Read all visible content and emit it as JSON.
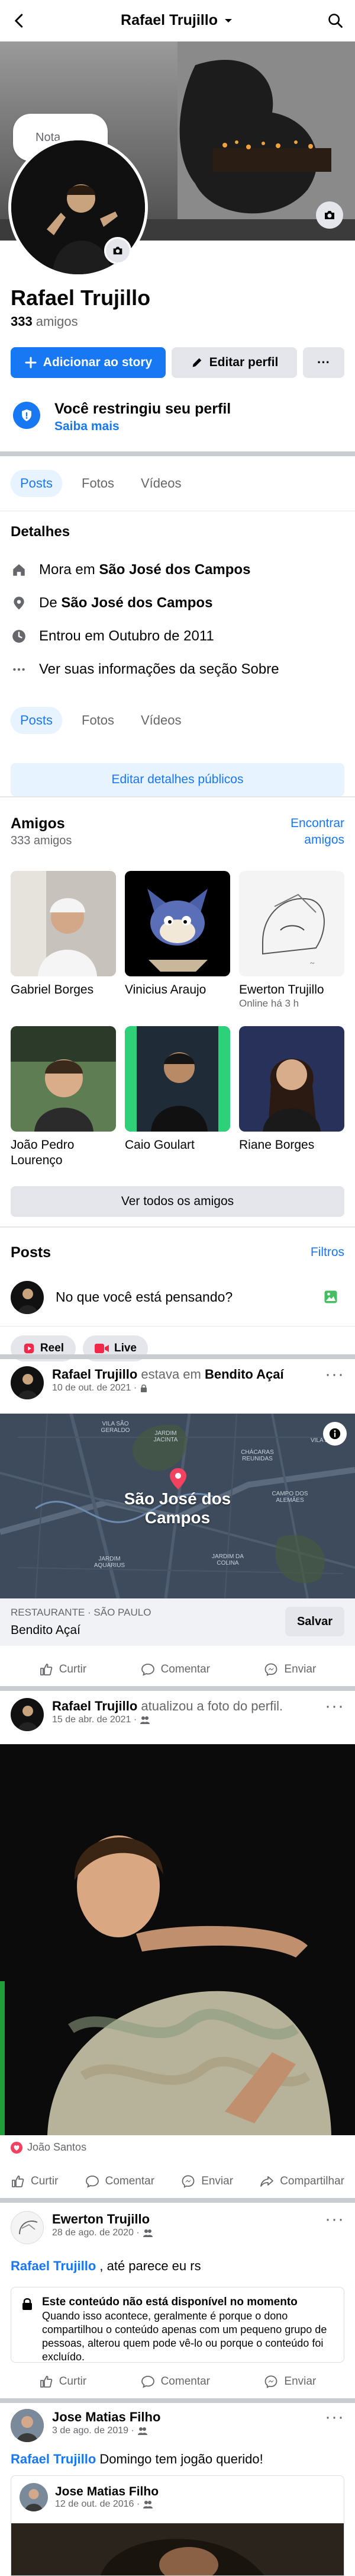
{
  "header": {
    "title": "Rafael Trujillo"
  },
  "profile": {
    "note_placeholder": "Nota...",
    "name": "Rafael Trujillo",
    "friends_count": "333",
    "friends_word": "amigos",
    "add_story": "Adicionar ao story",
    "edit_profile": "Editar perfil",
    "more": "···"
  },
  "restriction": {
    "title": "Você restringiu seu perfil",
    "link": "Saiba mais"
  },
  "tabs": [
    "Posts",
    "Fotos",
    "Vídeos"
  ],
  "details": {
    "heading": "Detalhes",
    "lives_prefix": "Mora em ",
    "lives_city": "São José dos Campos",
    "from_prefix": "De ",
    "from_city": "São José dos Campos",
    "joined": "Entrou em Outubro de 2011",
    "see_more": "Ver suas informações da seção Sobre",
    "edit_public": "Editar detalhes públicos"
  },
  "friends": {
    "heading": "Amigos",
    "count": "333 amigos",
    "find": "Encontrar amigos",
    "see_all": "Ver todos os amigos",
    "items": [
      {
        "name": "Gabriel Borges",
        "sub": ""
      },
      {
        "name": "Vinicius Araujo",
        "sub": ""
      },
      {
        "name": "Ewerton Trujillo",
        "sub": "Online há 3 h"
      },
      {
        "name": "João Pedro Lourenço",
        "sub": ""
      },
      {
        "name": "Caio Goulart",
        "sub": ""
      },
      {
        "name": "Riane Borges",
        "sub": ""
      }
    ]
  },
  "posts_section": {
    "heading": "Posts",
    "filters": "Filtros",
    "composer_placeholder": "No que você está pensando?",
    "reel": "Reel",
    "live": "Live"
  },
  "post1": {
    "author": "Rafael Trujillo",
    "action": " estava em ",
    "place": "Bendito Açaí",
    "date": "10 de out. de 2021 ·",
    "map_city": "São José dos Campos",
    "map_labels": [
      "VILA SÃO GERALDO",
      "JARDIM JACINTA",
      "CHÁCARAS REUNIDAS",
      "CAMPO DOS ALEMÃES",
      "JARDIM AQUARIUS",
      "JARDIM DA COLINA",
      "VILA JOSÉ"
    ],
    "category": "RESTAURANTE · SÃO PAULO",
    "place_name": "Bendito Açaí",
    "save": "Salvar"
  },
  "post2": {
    "author": "Rafael Trujillo",
    "action": " atualizou a foto do perfil.",
    "date": "15 de abr. de 2021 ·",
    "liker": "João Santos"
  },
  "post3": {
    "author": "Ewerton Trujillo",
    "date": "28 de ago. de 2020 ·",
    "mention": "Rafael Trujillo",
    "text": " , até parece eu rs",
    "unavailable_title": "Este conteúdo não está disponível no momento",
    "unavailable_body": "Quando isso acontece, geralmente é porque o dono compartilhou o conteúdo apenas com um pequeno grupo de pessoas, alterou quem pode vê-lo ou porque o conteúdo foi excluído."
  },
  "post4": {
    "author": "Jose Matias Filho",
    "date": "3 de ago. de 2019 ·",
    "mention": "Rafael Trujillo",
    "text": " Domingo tem jogão querido!",
    "shared_author": "Jose Matias Filho",
    "shared_date": "12 de out. de 2016 ·"
  },
  "actions": {
    "like": "Curtir",
    "comment": "Comentar",
    "send": "Enviar",
    "share": "Compartilhar"
  },
  "colors": {
    "accent": "#1877f2",
    "live": "#f02849",
    "photo": "#45bd62"
  }
}
